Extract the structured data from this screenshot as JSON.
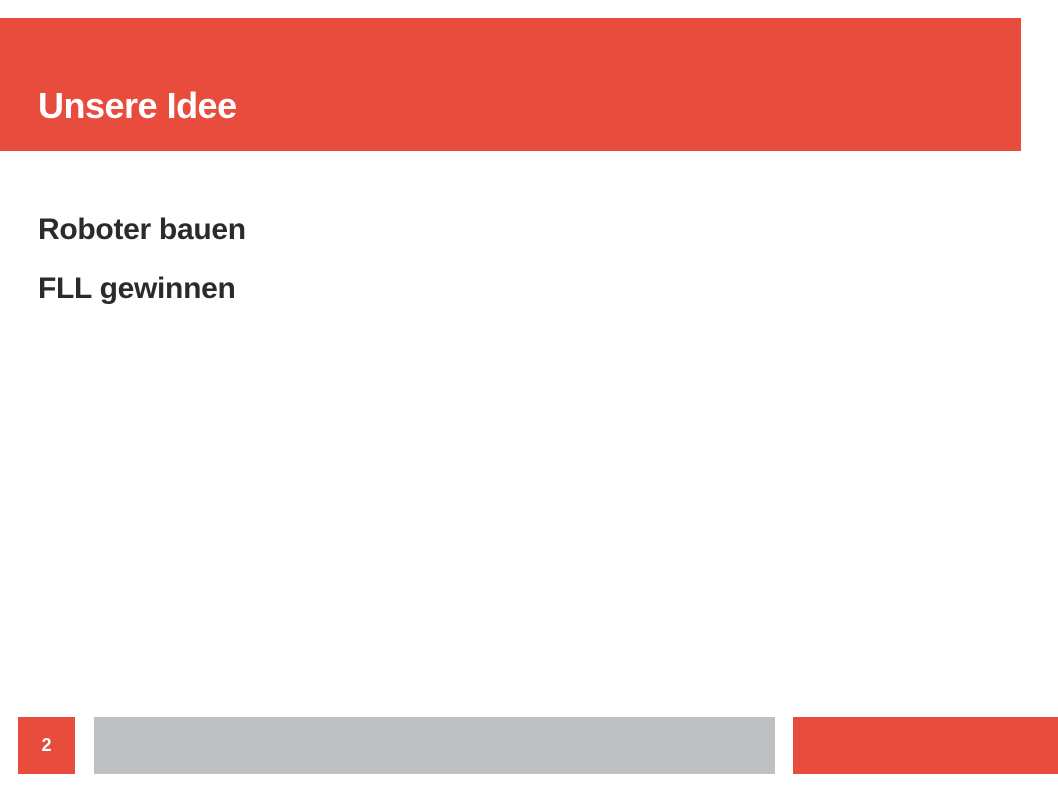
{
  "slide": {
    "title": "Unsere Idee",
    "bullets": [
      "Roboter bauen",
      "FLL gewinnen"
    ],
    "page_number": "2"
  },
  "colors": {
    "accent": "#e74c3c",
    "footer_gray": "#bdc1c4",
    "text": "#2b2b2b",
    "background": "#ffffff"
  }
}
